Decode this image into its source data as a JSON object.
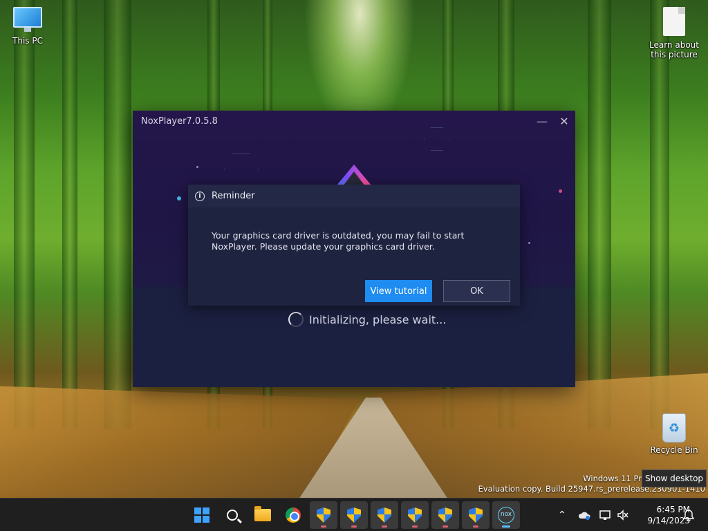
{
  "desktop": {
    "icons": [
      {
        "label": "This PC",
        "icon": "monitor-icon"
      },
      {
        "label": "Learn about\nthis picture",
        "icon": "document-icon"
      },
      {
        "label": "Recycle Bin",
        "icon": "recycle-bin-icon"
      }
    ],
    "watermark_line1": "Windows 11 Pr",
    "watermark_line2": "Evaluation copy. Build 25947.rs_prerelease.230901-1410",
    "tooltip": "Show desktop"
  },
  "nox_window": {
    "title": "NoxPlayer7.0.5.8",
    "minimize_glyph": "—",
    "close_glyph": "✕",
    "loading_text": "Initializing, please wait..."
  },
  "reminder_dialog": {
    "title": "Reminder",
    "info_glyph": "i",
    "message": "Your graphics card driver is outdated, you may fail to start\nNoxPlayer. Please update your graphics card driver.",
    "view_tutorial_label": "View tutorial",
    "ok_label": "OK"
  },
  "taskbar": {
    "items": [
      {
        "name": "start",
        "icon": "windows-logo-icon"
      },
      {
        "name": "search",
        "icon": "search-icon"
      },
      {
        "name": "file-explorer",
        "icon": "folder-icon"
      },
      {
        "name": "chrome",
        "icon": "chrome-icon"
      },
      {
        "name": "shield-app-1",
        "icon": "shield-icon"
      },
      {
        "name": "shield-app-2",
        "icon": "shield-icon"
      },
      {
        "name": "shield-app-3",
        "icon": "shield-icon"
      },
      {
        "name": "shield-app-4",
        "icon": "shield-icon"
      },
      {
        "name": "shield-app-5",
        "icon": "shield-icon"
      },
      {
        "name": "shield-app-6",
        "icon": "shield-icon"
      },
      {
        "name": "noxplayer",
        "icon": "nox-icon",
        "glyph": "nox"
      }
    ],
    "tray": {
      "chevron_glyph": "⌃",
      "time": "6:45 PM",
      "date": "9/14/2023"
    }
  },
  "colors": {
    "accent_blue": "#1e8cf0",
    "dialog_bg": "#1e2340",
    "taskbar_bg": "#1f1f1f"
  }
}
